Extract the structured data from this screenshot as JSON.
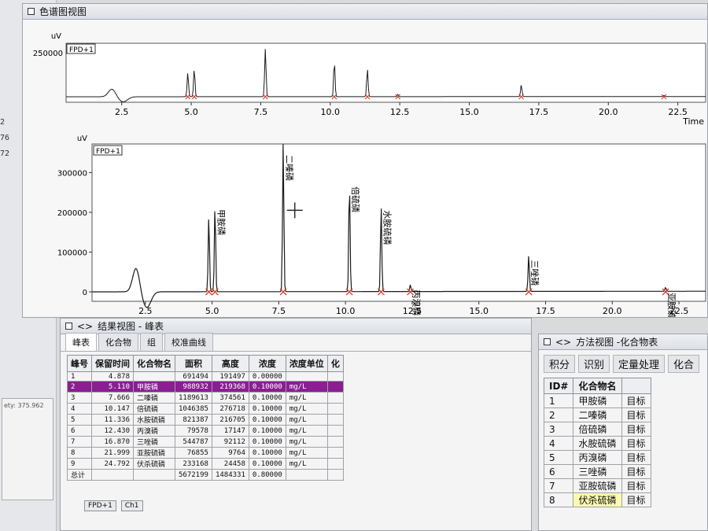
{
  "left_strip": {
    "ticks": [
      "2",
      "76",
      "72"
    ],
    "panel_text": "ety: 375.962"
  },
  "chromatogram_window": {
    "title": "色谱图视图",
    "top_chart": {
      "channel_label": "FPD+1",
      "y_unit": "uV",
      "y_tick": "250000",
      "x_ticks": [
        "2.5",
        "5.0",
        "7.5",
        "10.0",
        "12.5",
        "15.0",
        "17.5",
        "20.0",
        "22.5"
      ],
      "x_axis_title": "Time"
    },
    "main_chart": {
      "channel_label": "FPD+1",
      "y_unit": "uV",
      "y_ticks": [
        "300000",
        "200000",
        "100000",
        "0"
      ],
      "x_ticks": [
        "2.5",
        "5.0",
        "7.5",
        "10.0",
        "12.5",
        "15.0",
        "17.5",
        "20.0",
        "22.5"
      ],
      "peak_labels": [
        "甲胺磷",
        "二嗪磷",
        "倍硫磷",
        "水胺硫磷",
        "丙溴磷",
        "三唑磷",
        "亚胺硫磷"
      ]
    }
  },
  "chart_data": {
    "type": "line",
    "title": "",
    "xlabel": "Time",
    "ylabel": "uV",
    "xlim": [
      0.5,
      23.5
    ],
    "ylim": [
      -30000,
      360000
    ],
    "peaks": [
      {
        "rt": 4.878,
        "height": 191497,
        "label": ""
      },
      {
        "rt": 5.11,
        "height": 219368,
        "label": "甲胺磷"
      },
      {
        "rt": 7.666,
        "height": 374561,
        "label": "二嗪磷"
      },
      {
        "rt": 10.147,
        "height": 276718,
        "label": "倍硫磷"
      },
      {
        "rt": 11.336,
        "height": 216705,
        "label": "水胺硫磷"
      },
      {
        "rt": 12.43,
        "height": 17147,
        "label": "丙溴磷"
      },
      {
        "rt": 16.87,
        "height": 92112,
        "label": "三唑磷"
      },
      {
        "rt": 21.999,
        "height": 9764,
        "label": "亚胺硫磷"
      }
    ]
  },
  "results_window": {
    "title": "结果视图 - 峰表",
    "tabs": [
      "峰表",
      "化合物",
      "组",
      "校准曲线"
    ],
    "columns": [
      "峰号",
      "保留时间",
      "化合物名",
      "面积",
      "高度",
      "浓度",
      "浓度单位",
      "化"
    ],
    "rows": [
      {
        "id": "1",
        "rt": "4.878",
        "name": "",
        "area": "691494",
        "height": "191497",
        "conc": "0.00000",
        "unit": ""
      },
      {
        "id": "2",
        "rt": "5.110",
        "name": "甲胺磷",
        "area": "988932",
        "height": "219368",
        "conc": "0.10000",
        "unit": "mg/L"
      },
      {
        "id": "3",
        "rt": "7.666",
        "name": "二嗪磷",
        "area": "1189613",
        "height": "374561",
        "conc": "0.10000",
        "unit": "mg/L"
      },
      {
        "id": "4",
        "rt": "10.147",
        "name": "倍硫磷",
        "area": "1046385",
        "height": "276718",
        "conc": "0.10000",
        "unit": "mg/L"
      },
      {
        "id": "5",
        "rt": "11.336",
        "name": "水胺硫磷",
        "area": "821387",
        "height": "216705",
        "conc": "0.10000",
        "unit": "mg/L"
      },
      {
        "id": "6",
        "rt": "12.430",
        "name": "丙溴磷",
        "area": "79578",
        "height": "17147",
        "conc": "0.10000",
        "unit": "mg/L"
      },
      {
        "id": "7",
        "rt": "16.870",
        "name": "三唑磷",
        "area": "544787",
        "height": "92112",
        "conc": "0.10000",
        "unit": "mg/L"
      },
      {
        "id": "8",
        "rt": "21.999",
        "name": "亚胺硫磷",
        "area": "76855",
        "height": "9764",
        "conc": "0.10000",
        "unit": "mg/L"
      },
      {
        "id": "9",
        "rt": "24.792",
        "name": "伏杀硫磷",
        "area": "233168",
        "height": "24458",
        "conc": "0.10000",
        "unit": "mg/L"
      },
      {
        "id": "总计",
        "rt": "",
        "name": "",
        "area": "5672199",
        "height": "1484331",
        "conc": "0.80000",
        "unit": ""
      }
    ],
    "bottom_tabs": [
      "FPD+1",
      "Ch1"
    ]
  },
  "method_window": {
    "title": "方法视图 -化合物表",
    "tabs": [
      "积分",
      "识别",
      "定量处理",
      "化合"
    ],
    "columns": [
      "ID#",
      "化合物名"
    ],
    "rows": [
      {
        "id": "1",
        "name": "甲胺磷",
        "type": "目标"
      },
      {
        "id": "2",
        "name": "二嗪磷",
        "type": "目标"
      },
      {
        "id": "3",
        "name": "倍硫磷",
        "type": "目标"
      },
      {
        "id": "4",
        "name": "水胺硫磷",
        "type": "目标"
      },
      {
        "id": "5",
        "name": "丙溴磷",
        "type": "目标"
      },
      {
        "id": "6",
        "name": "三唑磷",
        "type": "目标"
      },
      {
        "id": "7",
        "name": "亚胺硫磷",
        "type": "目标"
      },
      {
        "id": "8",
        "name": "伏杀硫磷",
        "type": "目标"
      }
    ]
  },
  "colors": {
    "trace": "#1a1a1a",
    "marker": "#d8402c",
    "selection": "#8a1e92"
  }
}
